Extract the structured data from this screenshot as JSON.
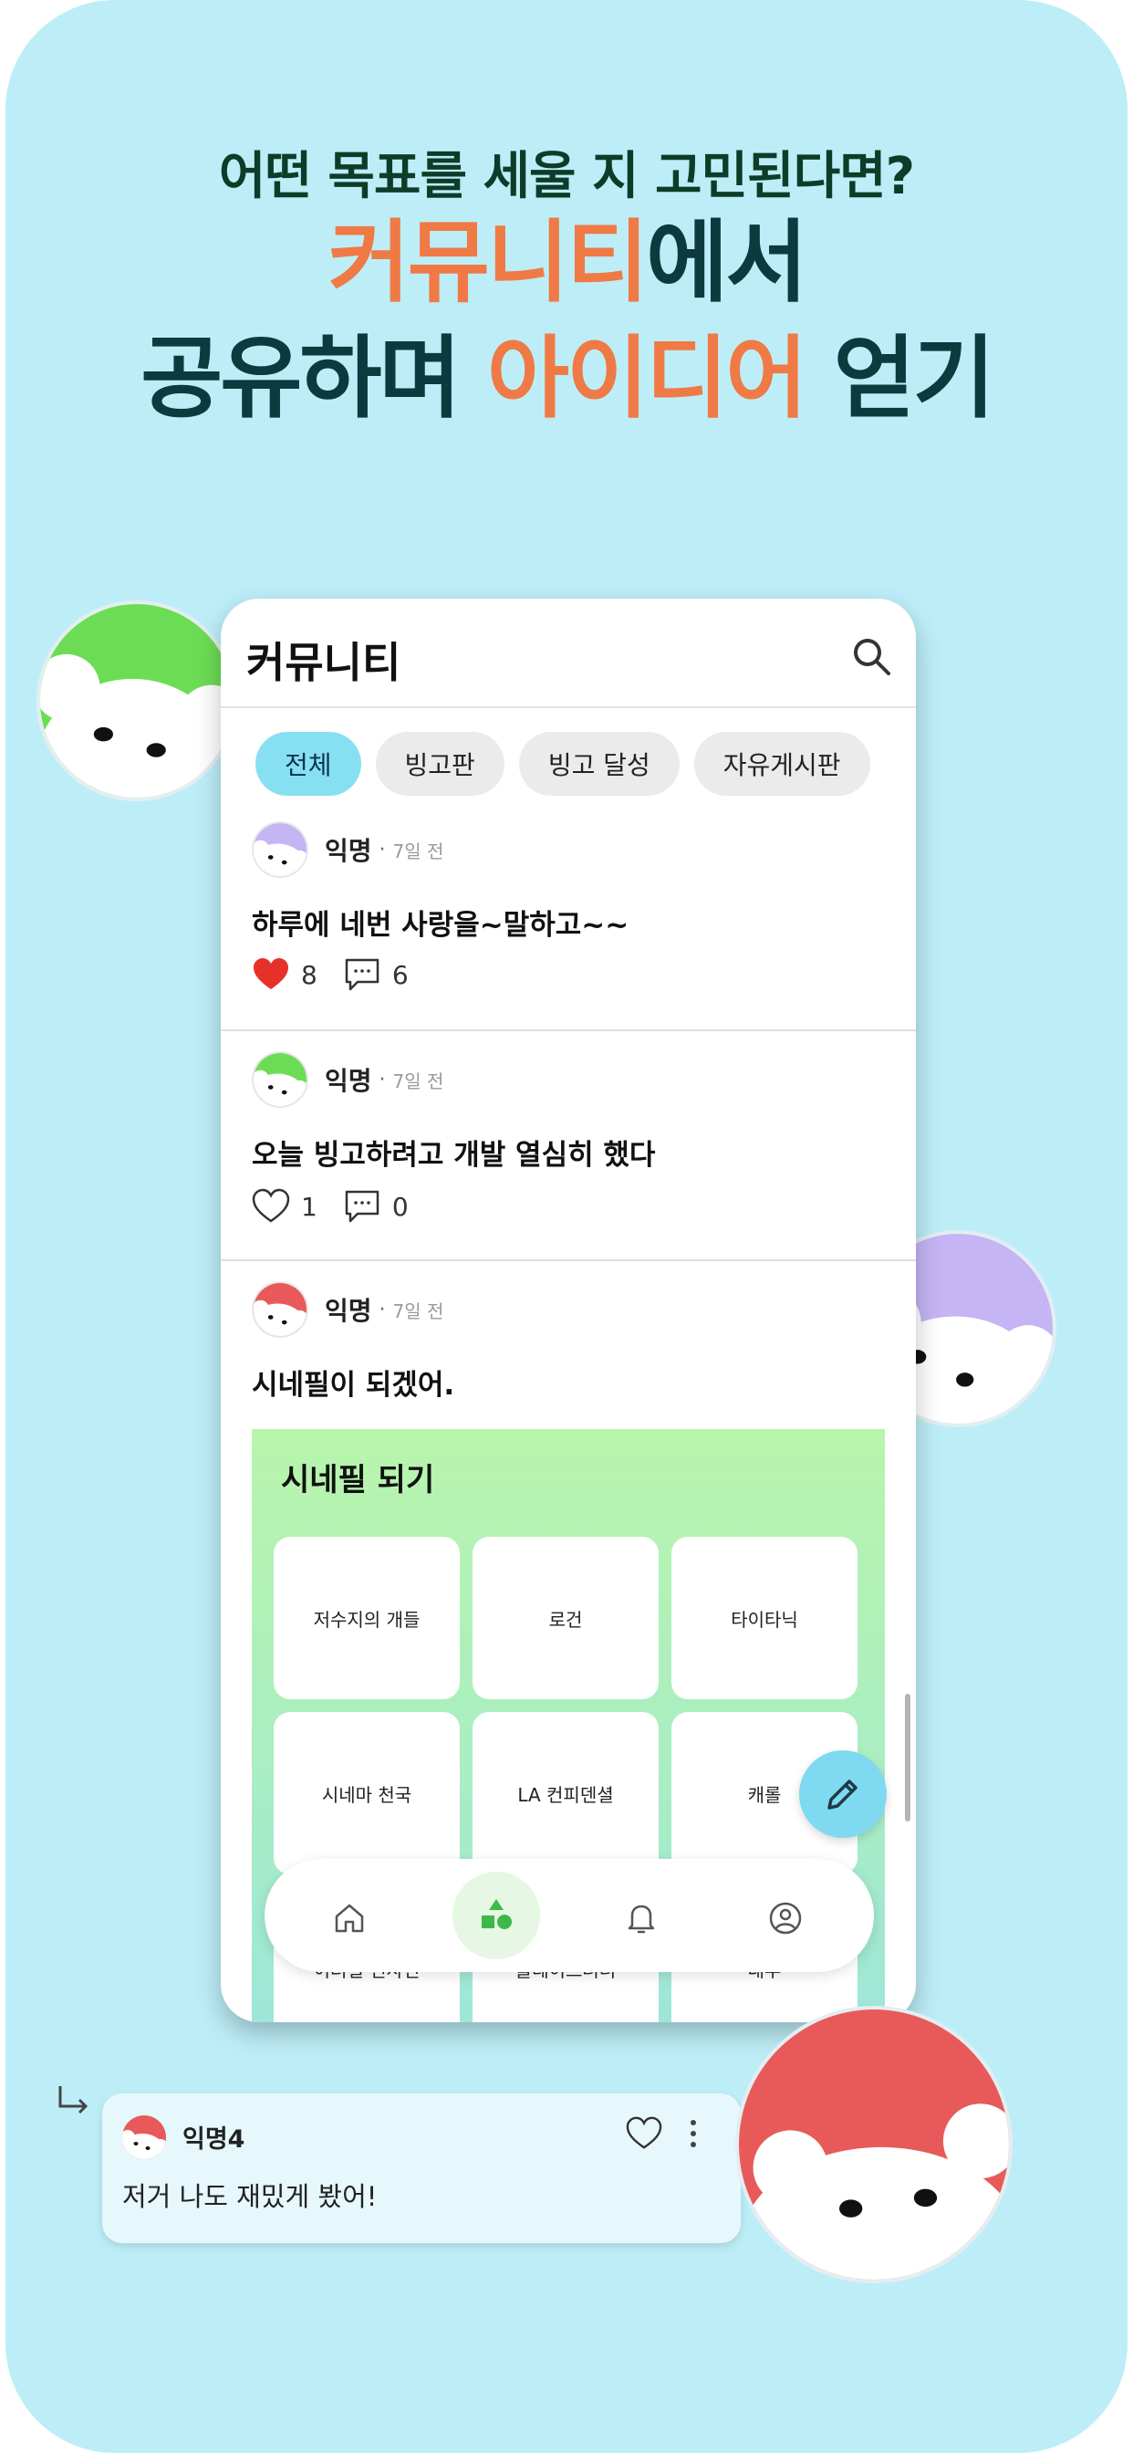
{
  "headline": {
    "line1": "어떤 목표를 세울 지 고민된다면?",
    "line2_highlight": "커뮤니티",
    "line2_rest": "에서",
    "line3_start": "공유하며 ",
    "line3_highlight": "아이디어",
    "line3_end": " 얻기"
  },
  "colors": {
    "background": "#bdeef8",
    "accent_orange": "#ef7a45",
    "headline_dark": "#0c3a3f",
    "chip_active": "#87e0f2",
    "avatar_green": "#6ddc55",
    "avatar_purple": "#c5b5f5",
    "avatar_red": "#e85a5a"
  },
  "app": {
    "title": "커뮤니티",
    "search_icon": "search-icon",
    "chips": [
      "전체",
      "빙고판",
      "빙고 달성",
      "자유게시판"
    ],
    "active_chip": "전체"
  },
  "posts": [
    {
      "author": "익명",
      "time": "7일 전",
      "text": "하루에 네번 사랑을~말하고~~",
      "likes": "8",
      "comments": "6",
      "liked": true,
      "avatar_color": "#c5b5f5"
    },
    {
      "author": "익명",
      "time": "7일 전",
      "text": "오늘 빙고하려고 개발 열심히 했다",
      "likes": "1",
      "comments": "0",
      "liked": false,
      "avatar_color": "#6ddc55"
    },
    {
      "author": "익명",
      "time": "7일 전",
      "text": "시네필이 되겠어.",
      "avatar_color": "#e85a5a"
    }
  ],
  "bingo": {
    "title": "시네필 되기",
    "cells": [
      "저수지의 개들",
      "로건",
      "타이타닉",
      "시네마 천국",
      "LA 컨피덴셜",
      "캐롤",
      "이터널 선샤인",
      "블레이드러너",
      "대부"
    ]
  },
  "bottom_nav": [
    "home-icon",
    "community-icon",
    "bell-icon",
    "profile-icon"
  ],
  "comment": {
    "author": "익명4",
    "text": "저거 나도 재밌게 봤어!",
    "avatar_color": "#e85a5a"
  }
}
